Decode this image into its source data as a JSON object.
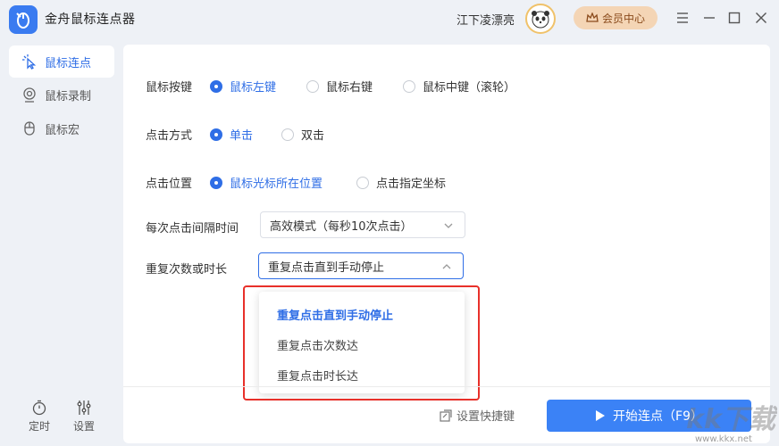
{
  "app": {
    "title": "金舟鼠标连点器"
  },
  "header": {
    "username": "江下凌漂亮",
    "vip_label": "会员中心"
  },
  "sidebar": {
    "items": [
      {
        "label": "鼠标连点",
        "icon": "cursor-click-icon",
        "active": true
      },
      {
        "label": "鼠标录制",
        "icon": "record-icon",
        "active": false
      },
      {
        "label": "鼠标宏",
        "icon": "mouse-icon",
        "active": false
      }
    ],
    "bottom": [
      {
        "label": "定时",
        "icon": "timer-icon"
      },
      {
        "label": "设置",
        "icon": "sliders-icon"
      }
    ]
  },
  "settings": {
    "button": {
      "label": "鼠标按键",
      "options": [
        "鼠标左键",
        "鼠标右键",
        "鼠标中键（滚轮）"
      ],
      "selected": 0
    },
    "click_type": {
      "label": "点击方式",
      "options": [
        "单击",
        "双击"
      ],
      "selected": 0
    },
    "position": {
      "label": "点击位置",
      "options": [
        "鼠标光标所在位置",
        "点击指定坐标"
      ],
      "selected": 0
    },
    "interval": {
      "label": "每次点击间隔时间",
      "value": "高效模式（每秒10次点击）"
    },
    "repeat": {
      "label": "重复次数或时长",
      "value": "重复点击直到手动停止",
      "options": [
        "重复点击直到手动停止",
        "重复点击次数达",
        "重复点击时长达"
      ]
    }
  },
  "footer": {
    "shortcut_label": "设置快捷键",
    "start_label": "开始连点（F9）"
  },
  "watermark": {
    "site": "www.kkx.net",
    "brand": "kk下载"
  },
  "colors": {
    "accent": "#3b82f6",
    "highlight": "#e8302a",
    "vip_bg": "#f4d5b5"
  }
}
